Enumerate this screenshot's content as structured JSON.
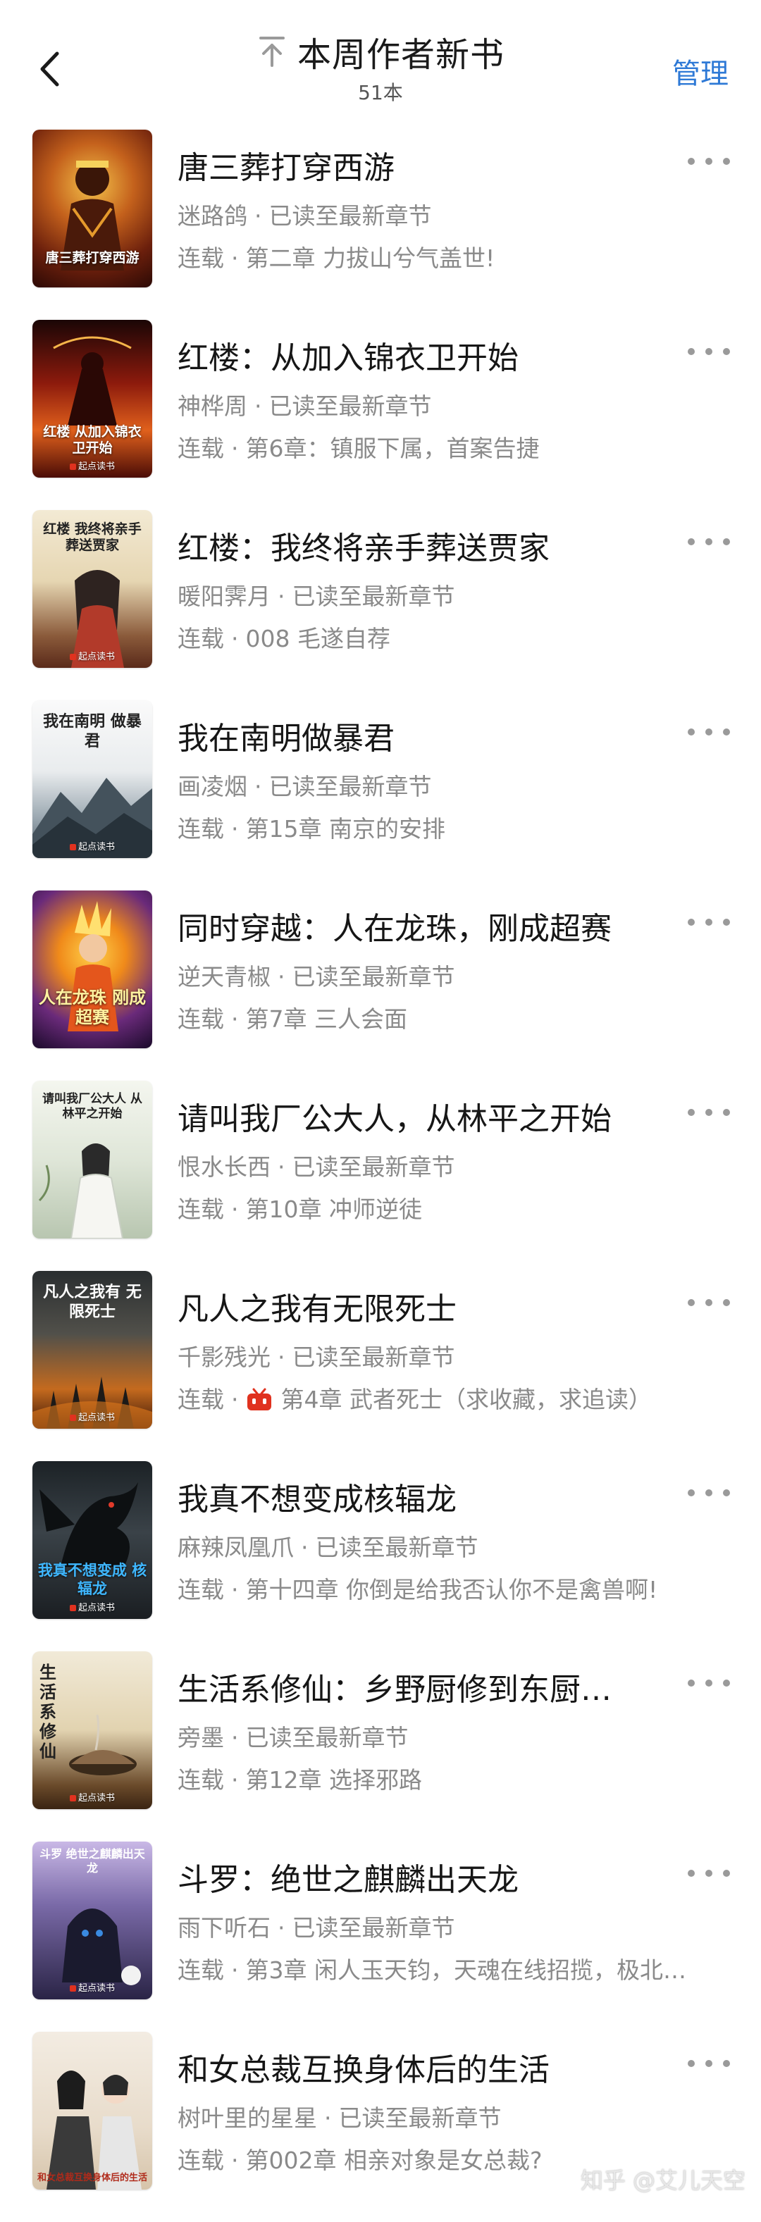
{
  "header": {
    "title": "本周作者新书",
    "subtitle": "51本",
    "manage_label": "管理"
  },
  "icons": {
    "back": "chevron-left-icon",
    "pin": "pin-to-top-icon",
    "more": "more-dots-icon",
    "video_badge": "video-badge-icon"
  },
  "colors": {
    "accent": "#2e79d6",
    "secondary_text": "#8a8a8a",
    "badge_red": "#e0321f"
  },
  "separator": "·",
  "books": [
    {
      "title": "唐三葬打穿西游",
      "author": "迷路鸽",
      "status": "已读至最新章节",
      "serial": "连载",
      "chapter": "第二章 力拔山兮气盖世!",
      "cover_text": "唐三葬打穿西游",
      "cover_publisher": ""
    },
    {
      "title": "红楼：从加入锦衣卫开始",
      "author": "神桦周",
      "status": "已读至最新章节",
      "serial": "连载",
      "chapter": "第6章：镇服下属，首案告捷",
      "cover_text": "红楼 从加入锦衣卫开始",
      "cover_publisher": "起点读书"
    },
    {
      "title": "红楼：我终将亲手葬送贾家",
      "author": "暖阳霁月",
      "status": "已读至最新章节",
      "serial": "连载",
      "chapter": "008 毛遂自荐",
      "cover_text": "红楼 我终将亲手葬送贾家",
      "cover_publisher": "起点读书"
    },
    {
      "title": "我在南明做暴君",
      "author": "画凌烟",
      "status": "已读至最新章节",
      "serial": "连载",
      "chapter": "第15章 南京的安排",
      "cover_text": "我在南明 做暴君",
      "cover_publisher": "起点读书"
    },
    {
      "title": "同时穿越：人在龙珠，刚成超赛",
      "author": "逆天青椒",
      "status": "已读至最新章节",
      "serial": "连载",
      "chapter": "第7章 三人会面",
      "cover_text": "人在龙珠 刚成超赛",
      "cover_publisher": ""
    },
    {
      "title": "请叫我厂公大人，从林平之开始",
      "author": "恨水长西",
      "status": "已读至最新章节",
      "serial": "连载",
      "chapter": "第10章 冲师逆徒",
      "cover_text": "请叫我厂公大人 从林平之开始",
      "cover_publisher": ""
    },
    {
      "title": "凡人之我有无限死士",
      "author": "千影残光",
      "status": "已读至最新章节",
      "serial": "连载",
      "chapter": "第4章 武者死士（求收藏，求追读）",
      "has_video_badge": true,
      "cover_text": "凡人之我有 无限死士",
      "cover_publisher": "起点读书"
    },
    {
      "title": "我真不想变成核辐龙",
      "author": "麻辣凤凰爪",
      "status": "已读至最新章节",
      "serial": "连载",
      "chapter": "第十四章 你倒是给我否认你不是禽兽啊!",
      "cover_text": "我真不想变成 核辐龙",
      "cover_publisher": "起点读书"
    },
    {
      "title": "生活系修仙：乡野厨修到东厨…",
      "author": "旁墨",
      "status": "已读至最新章节",
      "serial": "连载",
      "chapter": "第12章 选择邪路",
      "cover_text": "生活系修仙",
      "cover_publisher": "起点读书"
    },
    {
      "title": "斗罗：绝世之麒麟出天龙",
      "author": "雨下听石",
      "status": "已读至最新章节",
      "serial": "连载",
      "chapter": "第3章 闲人玉天钧，天魂在线招揽，极北…",
      "cover_text": "斗罗 绝世之麒麟出天龙",
      "cover_publisher": "起点读书"
    },
    {
      "title": "和女总裁互换身体后的生活",
      "author": "树叶里的星星",
      "status": "已读至最新章节",
      "serial": "连载",
      "chapter": "第002章 相亲对象是女总裁?",
      "cover_text": "和女总裁互换身体后的生活",
      "cover_publisher": ""
    }
  ],
  "watermark": "知乎 @艾儿天空"
}
